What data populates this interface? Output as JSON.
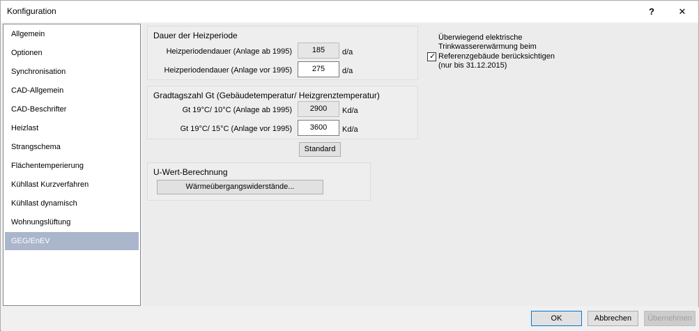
{
  "window": {
    "title": "Konfiguration",
    "help_label": "?",
    "close_label": "✕"
  },
  "sidebar": {
    "items": [
      {
        "label": "Allgemein"
      },
      {
        "label": "Optionen"
      },
      {
        "label": "Synchronisation"
      },
      {
        "label": "CAD-Allgemein"
      },
      {
        "label": "CAD-Beschrifter"
      },
      {
        "label": "Heizlast"
      },
      {
        "label": "Strangschema"
      },
      {
        "label": "Flächentemperierung"
      },
      {
        "label": "Kühllast Kurzverfahren"
      },
      {
        "label": "Kühllast dynamisch"
      },
      {
        "label": "Wohnungslüftung"
      },
      {
        "label": "GEG/EnEV"
      }
    ]
  },
  "heizperiode": {
    "title": "Dauer der Heizperiode",
    "rows": [
      {
        "label": "Heizperiodendauer (Anlage ab 1995)",
        "value": "185",
        "unit": "d/a"
      },
      {
        "label": "Heizperiodendauer (Anlage vor 1995)",
        "value": "275",
        "unit": "d/a"
      }
    ]
  },
  "gradtagszahl": {
    "title": "Gradtagszahl Gt (Gebäudetemperatur/ Heizgrenztemperatur)",
    "rows": [
      {
        "label": "Gt 19°C/ 10°C (Anlage ab 1995)",
        "value": "2900",
        "unit": "Kd/a"
      },
      {
        "label": "Gt 19°C/ 15°C (Anlage vor 1995)",
        "value": "3600",
        "unit": "Kd/a"
      }
    ],
    "standard_label": "Standard"
  },
  "uwert": {
    "title": "U-Wert-Berechnung",
    "button_label": "Wärmeübergangswiderstände..."
  },
  "option": {
    "line1": "Überwiegend elektrische",
    "line2": "Trinkwassererwärmung beim",
    "line3": "Referenzgebäude berücksichtigen",
    "line4": "(nur bis 31.12.2015)",
    "checked": true
  },
  "footer": {
    "ok": "OK",
    "cancel": "Abbrechen",
    "apply": "Übernehmen"
  }
}
